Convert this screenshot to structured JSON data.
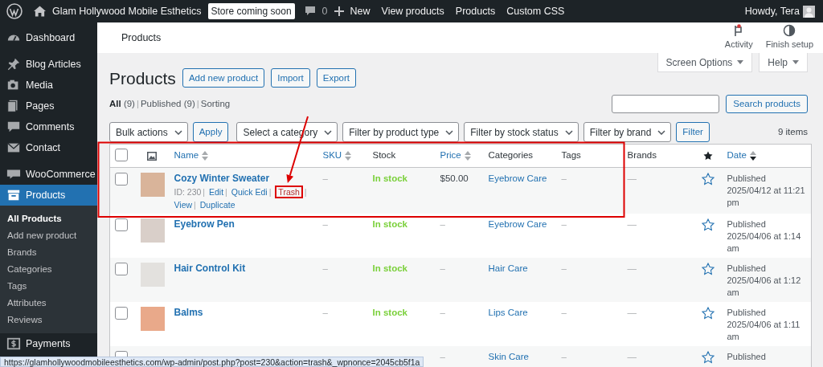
{
  "admin_bar": {
    "site_name": "Glam Hollywood Mobile Esthetics",
    "badge": "Store coming soon",
    "comments_count": "0",
    "new_label": "New",
    "links": [
      "View products",
      "Products",
      "Custom CSS"
    ],
    "greeting": "Howdy, Tera"
  },
  "sidebar": {
    "groups": [
      [
        {
          "label": "Dashboard",
          "selected": false
        }
      ],
      [
        {
          "label": "Blog Articles",
          "selected": false
        },
        {
          "label": "Media",
          "selected": false
        },
        {
          "label": "Pages",
          "selected": false
        },
        {
          "label": "Comments",
          "selected": false
        },
        {
          "label": "Contact",
          "selected": false
        }
      ],
      [
        {
          "label": "WooCommerce",
          "selected": false
        },
        {
          "label": "Products",
          "selected": true,
          "children": [
            {
              "label": "All Products",
              "selected": true
            },
            {
              "label": "Add new product",
              "selected": false
            },
            {
              "label": "Brands",
              "selected": false
            },
            {
              "label": "Categories",
              "selected": false
            },
            {
              "label": "Tags",
              "selected": false
            },
            {
              "label": "Attributes",
              "selected": false
            },
            {
              "label": "Reviews",
              "selected": false
            }
          ]
        },
        {
          "label": "Payments",
          "selected": false
        }
      ]
    ]
  },
  "header": {
    "title": "Products",
    "actions": [
      "Activity",
      "Finish setup"
    ],
    "activity_unread": true
  },
  "screen_tabs": [
    "Screen Options",
    "Help"
  ],
  "page": {
    "title": "Products",
    "buttons": [
      "Add new product",
      "Import",
      "Export"
    ],
    "separator": "|",
    "views": [
      {
        "label": "All",
        "count": "(9)",
        "selected": true
      },
      {
        "label": "Published",
        "count": "(9)",
        "selected": false
      },
      {
        "label": "Sorting",
        "selected": false
      }
    ],
    "search_button": "Search products",
    "bulk_action": "Bulk actions",
    "apply": "Apply",
    "filters": [
      "Select a category",
      "Filter by product type",
      "Filter by stock status",
      "Filter by brand"
    ],
    "filter_button": "Filter",
    "items_count": "9 items"
  },
  "table": {
    "select_all_checked": false,
    "columns": [
      {
        "kind": "checkbox"
      },
      {
        "kind": "thumbnail"
      },
      {
        "kind": "text",
        "label": "Name",
        "sortable": true,
        "sorted": false
      },
      {
        "kind": "text",
        "label": "SKU",
        "sortable": true,
        "sorted": false
      },
      {
        "kind": "text",
        "label": "Stock",
        "sortable": false
      },
      {
        "kind": "text",
        "label": "Price",
        "sortable": true,
        "sorted": false
      },
      {
        "kind": "text",
        "label": "Categories",
        "sortable": false
      },
      {
        "kind": "text",
        "label": "Tags",
        "sortable": false
      },
      {
        "kind": "text",
        "label": "Brands",
        "sortable": false
      },
      {
        "kind": "featured"
      },
      {
        "kind": "text",
        "label": "Date",
        "sortable": true,
        "sorted": true
      }
    ],
    "rows": [
      {
        "checked": false,
        "name": "Cozy Winter Sweater",
        "actions": [
          {
            "label": "ID: 230",
            "kind": "meta",
            "highlighted": false
          },
          {
            "label": "Edit",
            "kind": "link",
            "highlighted": false
          },
          {
            "label": "Quick Edi",
            "kind": "link",
            "highlighted": false
          },
          {
            "label": "Trash",
            "kind": "danger",
            "highlighted": true
          },
          {
            "label": "View",
            "kind": "link",
            "highlighted": false
          },
          {
            "label": "Duplicate",
            "kind": "link",
            "highlighted": false
          }
        ],
        "sku": "–",
        "stock": "In stock",
        "price": "$50.00",
        "categories": "Eyebrow Care",
        "tags": "–",
        "brands": "—",
        "featured": false,
        "status": "Published",
        "date": "2025/04/12 at 11:21 pm"
      },
      {
        "checked": false,
        "name": "Eyebrow Pen",
        "sku": "–",
        "stock": "In stock",
        "price": "–",
        "categories": "Eyebrow Care",
        "tags": "–",
        "brands": "—",
        "featured": false,
        "status": "Published",
        "date": "2025/04/06 at 1:14 am"
      },
      {
        "checked": false,
        "name": "Hair Control Kit",
        "sku": "–",
        "stock": "In stock",
        "price": "–",
        "categories": "Hair Care",
        "tags": "–",
        "brands": "—",
        "featured": false,
        "status": "Published",
        "date": "2025/04/06 at 1:12 am"
      },
      {
        "checked": false,
        "name": "Balms",
        "sku": "–",
        "stock": "In stock",
        "price": "–",
        "categories": "Lips Care",
        "tags": "–",
        "brands": "—",
        "featured": false,
        "status": "Published",
        "date": "2025/04/06 at 1:11 am"
      },
      {
        "checked": false,
        "price": "–",
        "categories": "Skin Care",
        "tags": "–",
        "brands": "—",
        "featured": false,
        "status": "Published"
      }
    ]
  },
  "status_url": "https://glamhollywoodmobileesthetics.com/wp-admin/post.php?post=230&action=trash&_wpnonce=2045cb5f1a"
}
